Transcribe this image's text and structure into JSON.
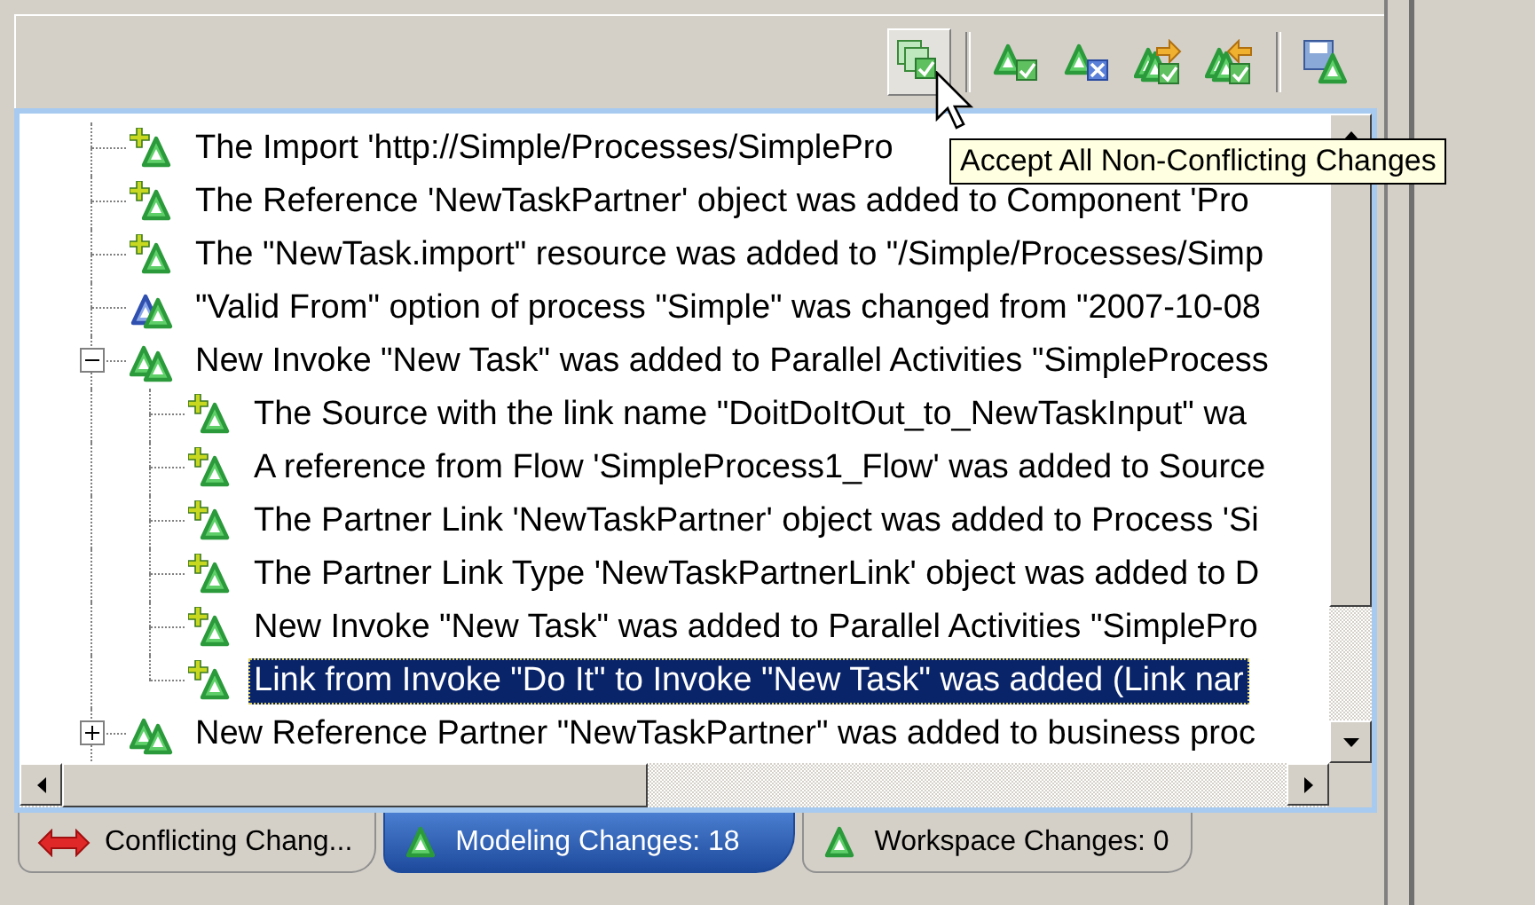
{
  "toolbar": {
    "buttons": [
      {
        "kind": "accept-all",
        "hovered": true
      },
      {
        "kind": "accept",
        "hovered": false
      },
      {
        "kind": "reject",
        "hovered": false
      },
      {
        "kind": "copy-right",
        "hovered": false
      },
      {
        "kind": "copy-left",
        "hovered": false
      },
      {
        "kind": "save",
        "hovered": false
      }
    ]
  },
  "tooltip": {
    "text": "Accept All Non-Conflicting Changes"
  },
  "tree": {
    "items": [
      {
        "kind": "add",
        "label": "The Import 'http://Simple/Processes/SimplePro",
        "selected": false
      },
      {
        "kind": "add",
        "label": "The Reference 'NewTaskPartner' object was added to Component 'Pro",
        "selected": false
      },
      {
        "kind": "add",
        "label": "The \"NewTask.import\" resource was added to \"/Simple/Processes/Simp",
        "selected": false
      },
      {
        "kind": "change",
        "label": "\"Valid From\" option of process \"Simple\" was changed from \"2007-10-08",
        "selected": false
      },
      {
        "kind": "group",
        "label": "New Invoke \"New Task\" was added to Parallel Activities \"SimpleProcess",
        "selected": false,
        "expanded": true,
        "children": [
          {
            "kind": "add",
            "label": "The Source with the link name \"DoitDoItOut_to_NewTaskInput\" wa",
            "selected": false
          },
          {
            "kind": "add",
            "label": "A reference from Flow 'SimpleProcess1_Flow' was added to Source",
            "selected": false
          },
          {
            "kind": "add",
            "label": "The Partner Link 'NewTaskPartner' object was added to Process 'Si",
            "selected": false
          },
          {
            "kind": "add",
            "label": "The Partner Link Type 'NewTaskPartnerLink' object was added to D",
            "selected": false
          },
          {
            "kind": "add",
            "label": "New Invoke \"New Task\" was added to Parallel Activities \"SimplePro",
            "selected": false
          },
          {
            "kind": "add",
            "label": "Link from Invoke \"Do It\" to Invoke \"New Task\" was added (Link nar",
            "selected": true
          }
        ]
      },
      {
        "kind": "group",
        "label": "New Reference Partner \"NewTaskPartner\" was added to business proc",
        "selected": false,
        "expanded": false
      }
    ]
  },
  "tabs": [
    {
      "kind": "conflict",
      "label": "Conflicting Chang...",
      "selected": false
    },
    {
      "kind": "modeling",
      "label": "Modeling Changes: 18",
      "selected": true
    },
    {
      "kind": "workspace",
      "label": "Workspace Changes: 0",
      "selected": false
    }
  ]
}
